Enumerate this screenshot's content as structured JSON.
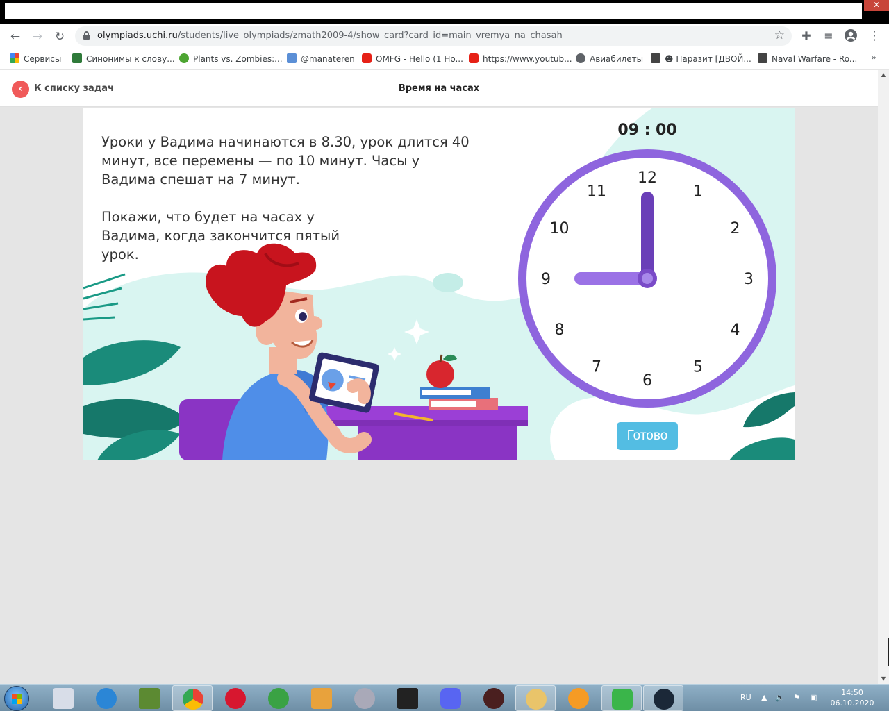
{
  "browser": {
    "url_host": "olympiads.uchi.ru",
    "url_path": "/students/live_olympiads/zmath2009-4/show_card?card_id=main_vremya_na_chasah",
    "bookmarks": [
      "Сервисы",
      "Синонимы к слову...",
      "Plants vs. Zombies:...",
      "@manateren",
      "OMFG - Hello (1 Ho...",
      "https://www.youtub...",
      "Авиабилеты",
      "☻ Паразит [ДВОЙ...",
      "Naval Warfare - Ro..."
    ],
    "bookmarks_more": "»"
  },
  "header": {
    "back_label": "К списку задач",
    "title": "Время на часах"
  },
  "task": {
    "paragraph1": "Уроки у Вадима начинаются в 8.30, урок длится 40 минут, все перемены — по 10 минут. Часы у Вадима спешат на 7 минут.",
    "paragraph2": "Покажи, что будет на часах у Вадима, когда закончится пятый урок."
  },
  "clock": {
    "time_display": "09 : 00",
    "hour": 9,
    "minute": 0,
    "numbers": [
      "12",
      "1",
      "2",
      "3",
      "4",
      "5",
      "6",
      "7",
      "8",
      "9",
      "10",
      "11"
    ],
    "face_color": "#8e65de",
    "hand_color": "#6a3fb8"
  },
  "done_button": "Готово",
  "taskbar": {
    "language": "RU",
    "time": "14:50",
    "date": "06.10.2020"
  }
}
